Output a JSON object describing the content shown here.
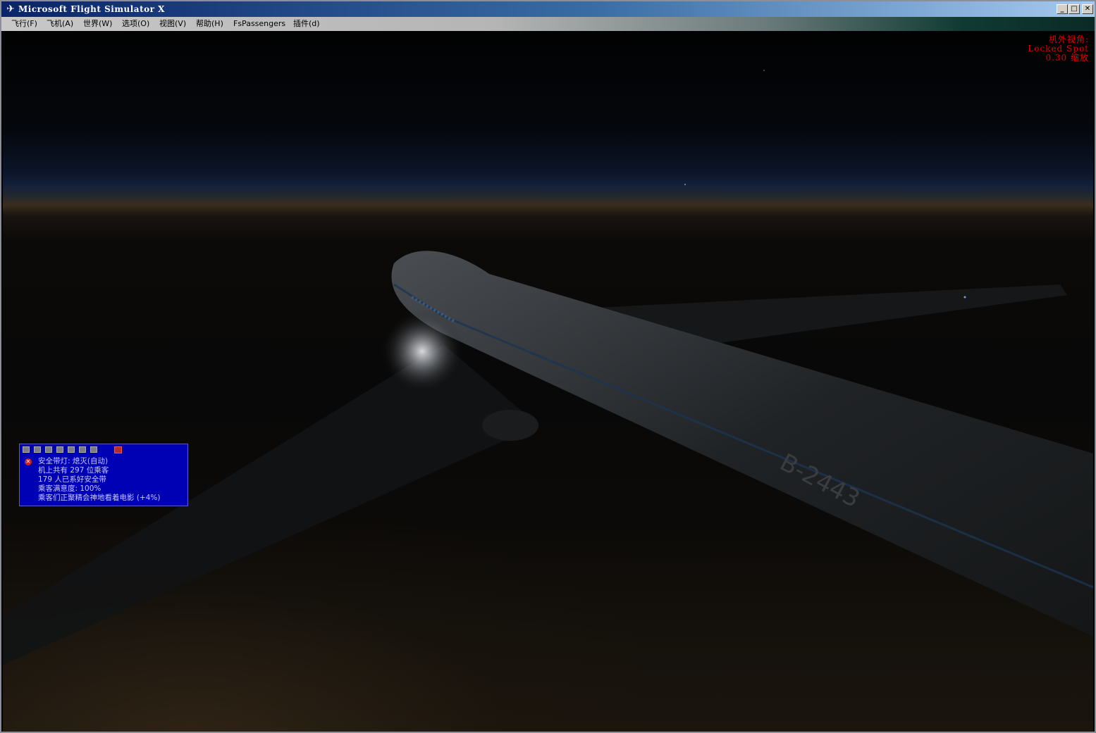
{
  "window": {
    "title": "Microsoft Flight Simulator X",
    "icon": "airplane-icon",
    "controls": {
      "minimize": "_",
      "maximize": "□",
      "close": "✕"
    }
  },
  "menu": {
    "items": [
      {
        "label": "飞行(F)"
      },
      {
        "label": "飞机(A)"
      },
      {
        "label": "世界(W)"
      },
      {
        "label": "选项(O)"
      },
      {
        "label": "视图(V)"
      },
      {
        "label": "帮助(H)"
      },
      {
        "label": "FsPassengers"
      },
      {
        "label": "插件(d)"
      }
    ]
  },
  "hud": {
    "line1": "机外视角:",
    "line2": "Locked Spot",
    "line3": "0.30 缩放",
    "color": "#e00000"
  },
  "aircraft": {
    "registration": "B-2443"
  },
  "fspassengers": {
    "lines": [
      "安全带灯: 熄灭(自动)",
      "机上共有 297 位乘客",
      "179 人已系好安全带",
      "乘客满意度: 100%",
      "乘客们正聚精会神地看着电影 (+4%)"
    ],
    "panel_color": "#0000b4"
  }
}
